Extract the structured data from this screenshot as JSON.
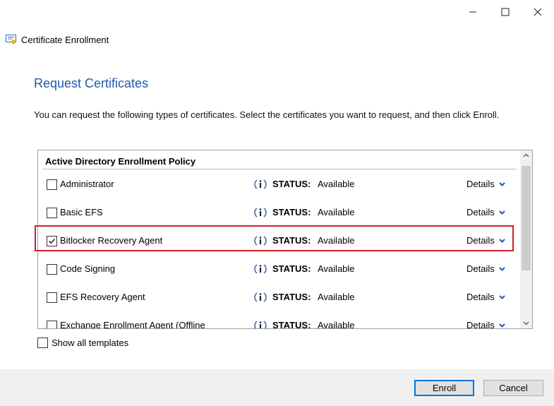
{
  "window": {
    "title": "Certificate Enrollment",
    "controls": {
      "minimize": "—",
      "maximize": "☐",
      "close": "✕"
    }
  },
  "page": {
    "heading": "Request Certificates",
    "intro": "You can request the following types of certificates. Select the certificates you want to request, and then click Enroll."
  },
  "list": {
    "group_header": "Active Directory Enrollment Policy",
    "status_label": "STATUS:",
    "details_label": "Details",
    "items": [
      {
        "name": "Administrator",
        "status": "Available",
        "checked": false
      },
      {
        "name": "Basic EFS",
        "status": "Available",
        "checked": false
      },
      {
        "name": "Bitlocker Recovery Agent",
        "status": "Available",
        "checked": true
      },
      {
        "name": "Code Signing",
        "status": "Available",
        "checked": false
      },
      {
        "name": "EFS Recovery Agent",
        "status": "Available",
        "checked": false
      },
      {
        "name": "Exchange Enrollment Agent (Offline",
        "status": "Available",
        "checked": false
      }
    ]
  },
  "options": {
    "show_all_templates": "Show all templates"
  },
  "buttons": {
    "enroll": "Enroll",
    "cancel": "Cancel"
  },
  "colors": {
    "heading": "#1f5bab",
    "highlight": "#d0202c",
    "accent": "#0078d7"
  }
}
